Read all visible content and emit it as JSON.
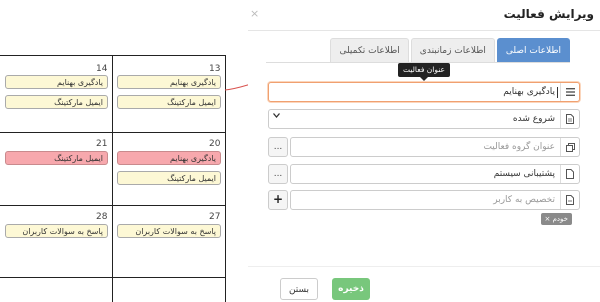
{
  "calendar": {
    "days": [
      {
        "number": "14",
        "events": [
          {
            "label": "یادگیری بهنایم",
            "color": "yellow"
          },
          {
            "label": "ایمیل مارکتینگ",
            "color": "yellow"
          }
        ]
      },
      {
        "number": "13",
        "events": [
          {
            "label": "یادگیری بهنایم",
            "color": "yellow"
          },
          {
            "label": "ایمیل مارکتینگ",
            "color": "yellow"
          }
        ]
      },
      {
        "number": "21",
        "events": [
          {
            "label": "ایمیل مارکتینگ",
            "color": "pink"
          }
        ]
      },
      {
        "number": "20",
        "events": [
          {
            "label": "یادگیری بهنایم",
            "color": "pink"
          },
          {
            "label": "ایمیل مارکتینگ",
            "color": "yellow"
          }
        ]
      },
      {
        "number": "28",
        "events": [
          {
            "label": "پاسخ به سوالات کاربران",
            "color": "yellow"
          }
        ]
      },
      {
        "number": "27",
        "events": [
          {
            "label": "پاسخ به سوالات کاربران",
            "color": "yellow"
          }
        ]
      }
    ]
  },
  "modal": {
    "title": "ویرایش فعالیت",
    "close": "×",
    "tabs": [
      "اطلاعات اصلی",
      "اطلاعات زمانبندی",
      "اطلاعات تکمیلی"
    ],
    "tooltip": "عنوان فعالیت",
    "fields": {
      "title_value": "یادگیری بهنایم",
      "status_value": "شروع شده",
      "group_placeholder": "عنوان گروه فعالیت",
      "group_button": "...",
      "category_value": "پشتیبانی سیستم",
      "category_button": "...",
      "assign_placeholder": "تخصیص به کاربر",
      "assign_button": "+"
    },
    "assignee_tag": "خودم ×",
    "buttons": {
      "save": "ذخیره",
      "close": "بستن"
    }
  },
  "colors": {
    "active_tab": "#5b8fcf",
    "save_button": "#78c77c",
    "event_yellow": "#fdf8d5",
    "event_pink": "#f7a8ad",
    "focus_border": "#f0a070"
  },
  "icons": [
    "list-icon",
    "document-icon",
    "copy-icon",
    "page-icon",
    "user-page-icon",
    "chevron-down-icon",
    "arrow-icon"
  ]
}
